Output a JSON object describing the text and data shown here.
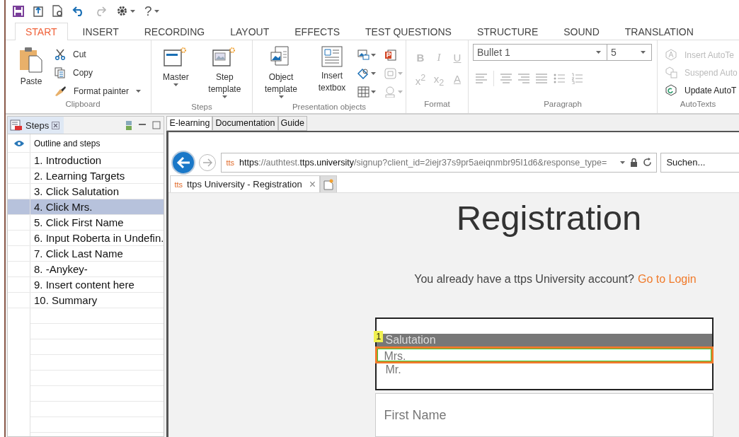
{
  "quick_access": {
    "redo": {
      "disabled": true
    },
    "help": "?"
  },
  "tabs": [
    {
      "label": "START",
      "selected": true
    },
    {
      "label": "INSERT",
      "selected": false
    },
    {
      "label": "RECORDING",
      "selected": false
    },
    {
      "label": "LAYOUT",
      "selected": false
    },
    {
      "label": "EFFECTS",
      "selected": false
    },
    {
      "label": "TEST QUESTIONS",
      "selected": false
    },
    {
      "label": "STRUCTURE",
      "selected": false
    },
    {
      "label": "SOUND",
      "selected": false
    },
    {
      "label": "TRANSLATION",
      "selected": false
    }
  ],
  "ribbon": {
    "clipboard": {
      "label": "Clipboard",
      "paste": "Paste",
      "cut": "Cut",
      "copy": "Copy",
      "format_painter": "Format painter"
    },
    "steps": {
      "label": "Steps",
      "master": "Master",
      "step_template": "Step template"
    },
    "presentation_objects": {
      "label": "Presentation objects",
      "object_template": "Object template",
      "insert_textbox": "Insert textbox",
      "small_tools": [
        {
          "disabled": false
        },
        {
          "disabled": false
        },
        {
          "disabled": false
        },
        {
          "disabled": false
        },
        {
          "disabled": true
        },
        {
          "disabled": true
        }
      ]
    },
    "format": {
      "label": "Format",
      "buttons": [
        {
          "label": "B",
          "disabled": true
        },
        {
          "label": "I",
          "disabled": true
        },
        {
          "label": "U",
          "disabled": true
        },
        {
          "label": "x$^{2}$",
          "disabled": true
        },
        {
          "label": "x$_{2}$",
          "disabled": true
        },
        {
          "label": "A",
          "disabled": true
        }
      ]
    },
    "paragraph": {
      "label": "Paragraph",
      "style": "Bullet 1",
      "size": "5"
    },
    "autotexts": {
      "label": "AutoTexts",
      "items": [
        {
          "label": "Insert AutoTe",
          "disabled": true
        },
        {
          "label": "Suspend Auto",
          "disabled": true
        },
        {
          "label": "Update AutoT",
          "disabled": false
        }
      ]
    }
  },
  "steps_panel": {
    "title": "Steps",
    "column_header": "Outline and steps",
    "steps": [
      {
        "label": "1. Introduction",
        "selected": false
      },
      {
        "label": "2. Learning Targets",
        "selected": false
      },
      {
        "label": "3. Click Salutation",
        "selected": false
      },
      {
        "label": "4. Click Mrs.",
        "selected": true
      },
      {
        "label": "5. Click First Name",
        "selected": false
      },
      {
        "label": "6. Input Roberta in Undefin.",
        "selected": false
      },
      {
        "label": "7. Click Last Name",
        "selected": false
      },
      {
        "label": "8.   -Anykey-",
        "selected": false
      },
      {
        "label": "9. Insert content here",
        "selected": false
      },
      {
        "label": "10. Summary",
        "selected": false
      }
    ]
  },
  "doc_tabs": [
    {
      "label": "E-learning",
      "selected": true
    },
    {
      "label": "Documentation",
      "selected": false
    },
    {
      "label": "Guide",
      "selected": false
    }
  ],
  "browser": {
    "favicon": "tts",
    "url": "**https**://authtest.**ttps.university**/signup?client_id=2iejr37s9pr5aeiqnmbr95I1d6&response_type=",
    "search": {
      "placeholder": "Suchen..."
    },
    "tab": {
      "favicon": "tts",
      "title": "ttps University - Registration",
      "close": "×"
    }
  },
  "page": {
    "heading": "Registration",
    "account_prompt": "You already have a ttps University account?",
    "login_link": "Go to Login",
    "marker": "1",
    "salutation_options": [
      {
        "label": "Salutation",
        "selected": true,
        "framed": false
      },
      {
        "label": "Mrs.",
        "selected": false,
        "framed": true
      },
      {
        "label": "Mr.",
        "selected": false,
        "framed": false
      }
    ],
    "first_name": {
      "placeholder": "First Name"
    }
  }
}
